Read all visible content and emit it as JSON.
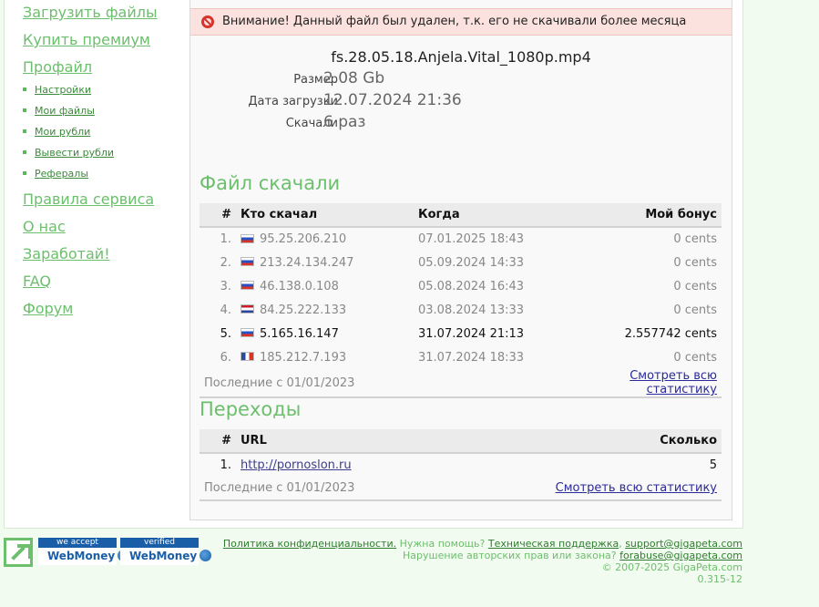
{
  "sidebar": {
    "primary_top": [
      {
        "label": "Загрузить файлы"
      },
      {
        "label": "Купить премиум"
      },
      {
        "label": "Профайл"
      }
    ],
    "profile_items": [
      {
        "label": "Настройки"
      },
      {
        "label": "Мои файлы"
      },
      {
        "label": "Мои рубли"
      },
      {
        "label": "Вывести рубли"
      },
      {
        "label": "Рефералы"
      }
    ],
    "primary_bottom": [
      {
        "label": "Правила сервиса"
      },
      {
        "label": "О нас"
      },
      {
        "label": "Заработай!"
      },
      {
        "label": "FAQ"
      },
      {
        "label": "Форум"
      }
    ]
  },
  "alert": {
    "text": "Внимание! Данный файл был удален, т.к. его не скачивали более месяца",
    "icon": "no-entry-icon"
  },
  "file": {
    "name": "fs.28.05.18.Anjela.Vital_1080p.mp4",
    "size_label": "Размер",
    "size_value": "2.08 Gb",
    "date_label": "Дата загрузки",
    "date_value": "12.07.2024 21:36",
    "downloads_label": "Скачали",
    "downloads_value": "6 раз"
  },
  "downloads": {
    "title": "Файл скачали",
    "headers": {
      "num": "#",
      "who": "Кто скачал",
      "when": "Когда",
      "bonus": "Мой бонус"
    },
    "rows": [
      {
        "num": "1.",
        "flag": "ru",
        "ip": "95.25.206.210",
        "when": "07.01.2025 18:43",
        "bonus": "0 cents",
        "highlight": false
      },
      {
        "num": "2.",
        "flag": "ru",
        "ip": "213.24.134.247",
        "when": "05.09.2024 14:33",
        "bonus": "0 cents",
        "highlight": false
      },
      {
        "num": "3.",
        "flag": "ru",
        "ip": "46.138.0.108",
        "when": "05.08.2024 16:43",
        "bonus": "0 cents",
        "highlight": false
      },
      {
        "num": "4.",
        "flag": "nl",
        "ip": "84.25.222.133",
        "when": "03.08.2024 13:33",
        "bonus": "0 cents",
        "highlight": false
      },
      {
        "num": "5.",
        "flag": "ru",
        "ip": "5.165.16.147",
        "when": "31.07.2024 21:13",
        "bonus": "2.557742 cents",
        "highlight": true
      },
      {
        "num": "6.",
        "flag": "fr",
        "ip": "185.212.7.193",
        "when": "31.07.2024 18:33",
        "bonus": "0 cents",
        "highlight": false
      }
    ],
    "footer_since": "Последние с 01/01/2023",
    "footer_link": "Смотреть всю статистику"
  },
  "referrals": {
    "title": "Переходы",
    "headers": {
      "num": "#",
      "url": "URL",
      "count": "Сколько"
    },
    "rows": [
      {
        "num": "1.",
        "url": "http://pornoslon.ru",
        "count": "5"
      }
    ],
    "footer_since": "Последние с 01/01/2023",
    "footer_link": "Смотреть всю статистику"
  },
  "footer": {
    "badge1_top": "we accept",
    "badge1_bottom": "WebMoney",
    "badge2_top": "verified",
    "badge2_bottom": "WebMoney",
    "privacy": "Политика конфиденциальности.",
    "help_text": "Нужна помощь?",
    "support_link": "Техническая поддержка",
    "support_email": "support@gigapeta.com",
    "abuse_text": "Нарушение авторских прав или закона?",
    "abuse_email": "forabuse@gigapeta.com",
    "copyright": "© 2007-2025 GigaPeta.com",
    "version": "0.315-12"
  },
  "colors": {
    "accent_green": "#6cbf6c",
    "alert_bg": "#fbe2df",
    "alert_icon": "#d7342c"
  }
}
